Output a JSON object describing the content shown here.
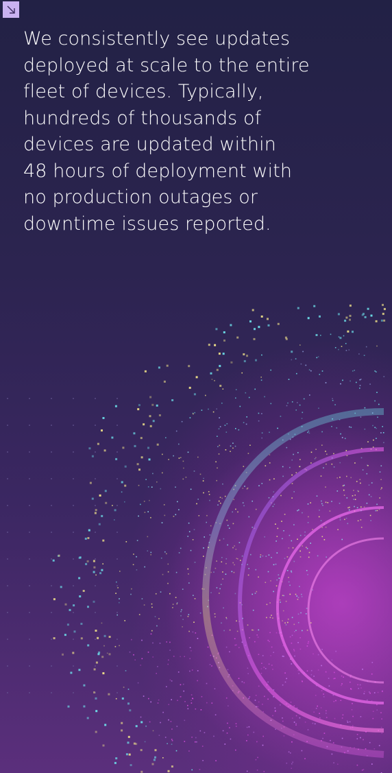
{
  "quote": {
    "lines": [
      "We consistently see updates",
      "deployed at scale to the entire",
      "fleet of devices. Typically,",
      "hundreds of thousands of",
      "devices are updated within",
      "48 hours of deployment with",
      "no production outages or",
      "downtime issues reported."
    ]
  },
  "icons": {
    "corner": "arrow-down-right-icon"
  },
  "colors": {
    "background_top": "#222145",
    "background_bottom": "#5b2f7c",
    "corner_button": "#c9b2f0",
    "text": "#ffffff",
    "swirl_magenta": "#d94fe0",
    "swirl_cyan": "#6fe6ef",
    "swirl_yellow": "#f3e58a"
  }
}
